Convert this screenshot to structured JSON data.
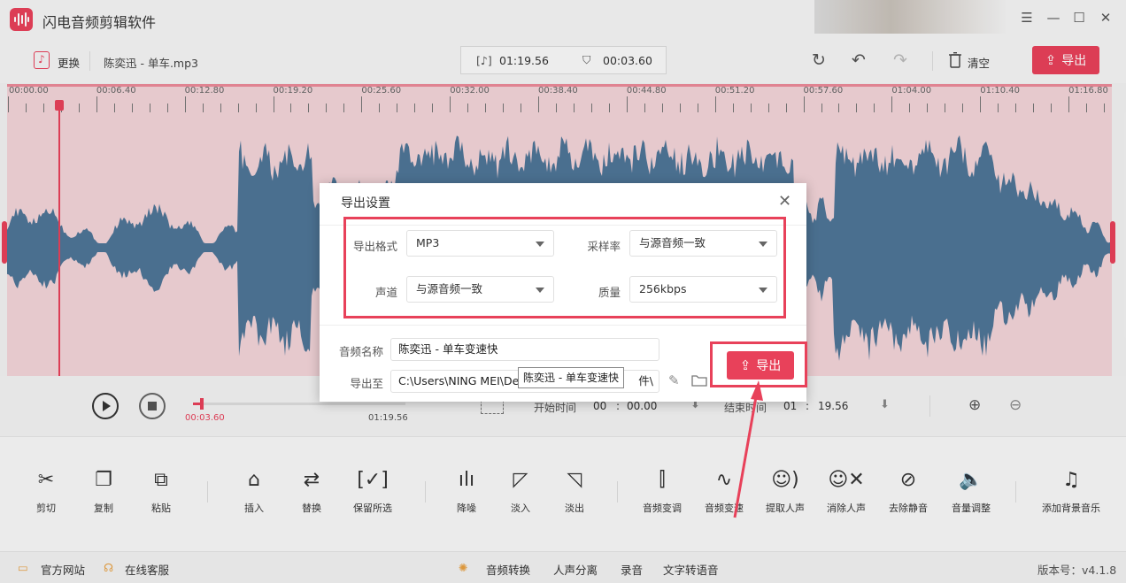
{
  "app": {
    "title": "闪电音频剪辑软件"
  },
  "toolbar": {
    "replace_label": "更换",
    "file_name": "陈奕迅 - 单车.mp3",
    "duration": "01:19.56",
    "cursor_time": "00:03.60",
    "clear_label": "清空",
    "export_label": "导出"
  },
  "timeline": {
    "ticks": [
      "00:00.00",
      "00:06.40",
      "00:12.80",
      "00:19.20",
      "00:25.60",
      "00:32.00",
      "00:38.40",
      "00:44.80",
      "00:51.20",
      "00:57.60",
      "01:04.00",
      "01:10.40",
      "01:16.80"
    ]
  },
  "playback": {
    "current": "00:03.60",
    "total": "01:19.56",
    "progress_fraction": 0.045,
    "start_label": "开始时间",
    "start_min": "00",
    "start_sec": "00.00",
    "end_label": "结束时间",
    "end_min": "01",
    "end_sec": "19.56"
  },
  "tools": [
    {
      "label": "剪切",
      "icon": "scissors-icon"
    },
    {
      "label": "复制",
      "icon": "copy-icon"
    },
    {
      "label": "粘贴",
      "icon": "paste-icon"
    },
    {
      "label": "插入",
      "icon": "insert-icon"
    },
    {
      "label": "替换",
      "icon": "replace-icon"
    },
    {
      "label": "保留所选",
      "icon": "keep-selection-icon"
    },
    {
      "label": "降噪",
      "icon": "denoise-icon"
    },
    {
      "label": "淡入",
      "icon": "fade-in-icon"
    },
    {
      "label": "淡出",
      "icon": "fade-out-icon"
    },
    {
      "label": "音频变调",
      "icon": "pitch-icon"
    },
    {
      "label": "音频变速",
      "icon": "speed-icon"
    },
    {
      "label": "提取人声",
      "icon": "extract-voice-icon"
    },
    {
      "label": "消除人声",
      "icon": "remove-voice-icon"
    },
    {
      "label": "去除静音",
      "icon": "remove-silence-icon"
    },
    {
      "label": "音量调整",
      "icon": "volume-icon"
    },
    {
      "label": "添加背景音乐",
      "icon": "music-note-icon"
    }
  ],
  "footer": {
    "website": "官方网站",
    "support": "在线客服",
    "convert": "音频转换",
    "separate": "人声分离",
    "record": "录音",
    "tts": "文字转语音",
    "version": "版本号：v4.1.8"
  },
  "dialog": {
    "title": "导出设置",
    "format_label": "导出格式",
    "format_value": "MP3",
    "samplerate_label": "采样率",
    "samplerate_value": "与源音频一致",
    "channel_label": "声道",
    "channel_value": "与源音频一致",
    "quality_label": "质量",
    "quality_value": "256kbps",
    "name_label": "音频名称",
    "name_value": "陈奕迅 - 单车变速快",
    "path_label": "导出至",
    "path_value": "C:\\Users\\NING MEI\\De",
    "path_tail": "件\\",
    "tooltip": "陈奕迅 - 单车变速快",
    "export_label": "导出"
  },
  "colors": {
    "accent": "#e8415a",
    "wave": "#4f7597",
    "selection": "#f3d4d9"
  }
}
